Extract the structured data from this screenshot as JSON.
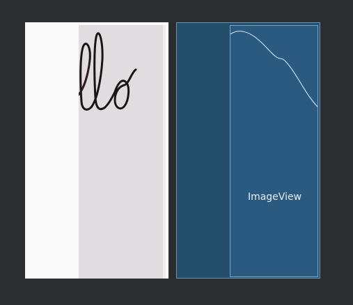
{
  "blueprint": {
    "component_label": "ImageView"
  },
  "colors": {
    "background": "#2c2d2f",
    "design_surface": "#f9f9f9",
    "design_image": "#e1dcdf",
    "blueprint_fill": "#24506f",
    "blueprint_highlight": "#2a5a80",
    "blueprint_outline": "#7ea4c3",
    "ink": "#1a1414"
  },
  "icons": {
    "handwriting": "handwriting-image",
    "blueprint_outline": "image-outline-curve"
  }
}
